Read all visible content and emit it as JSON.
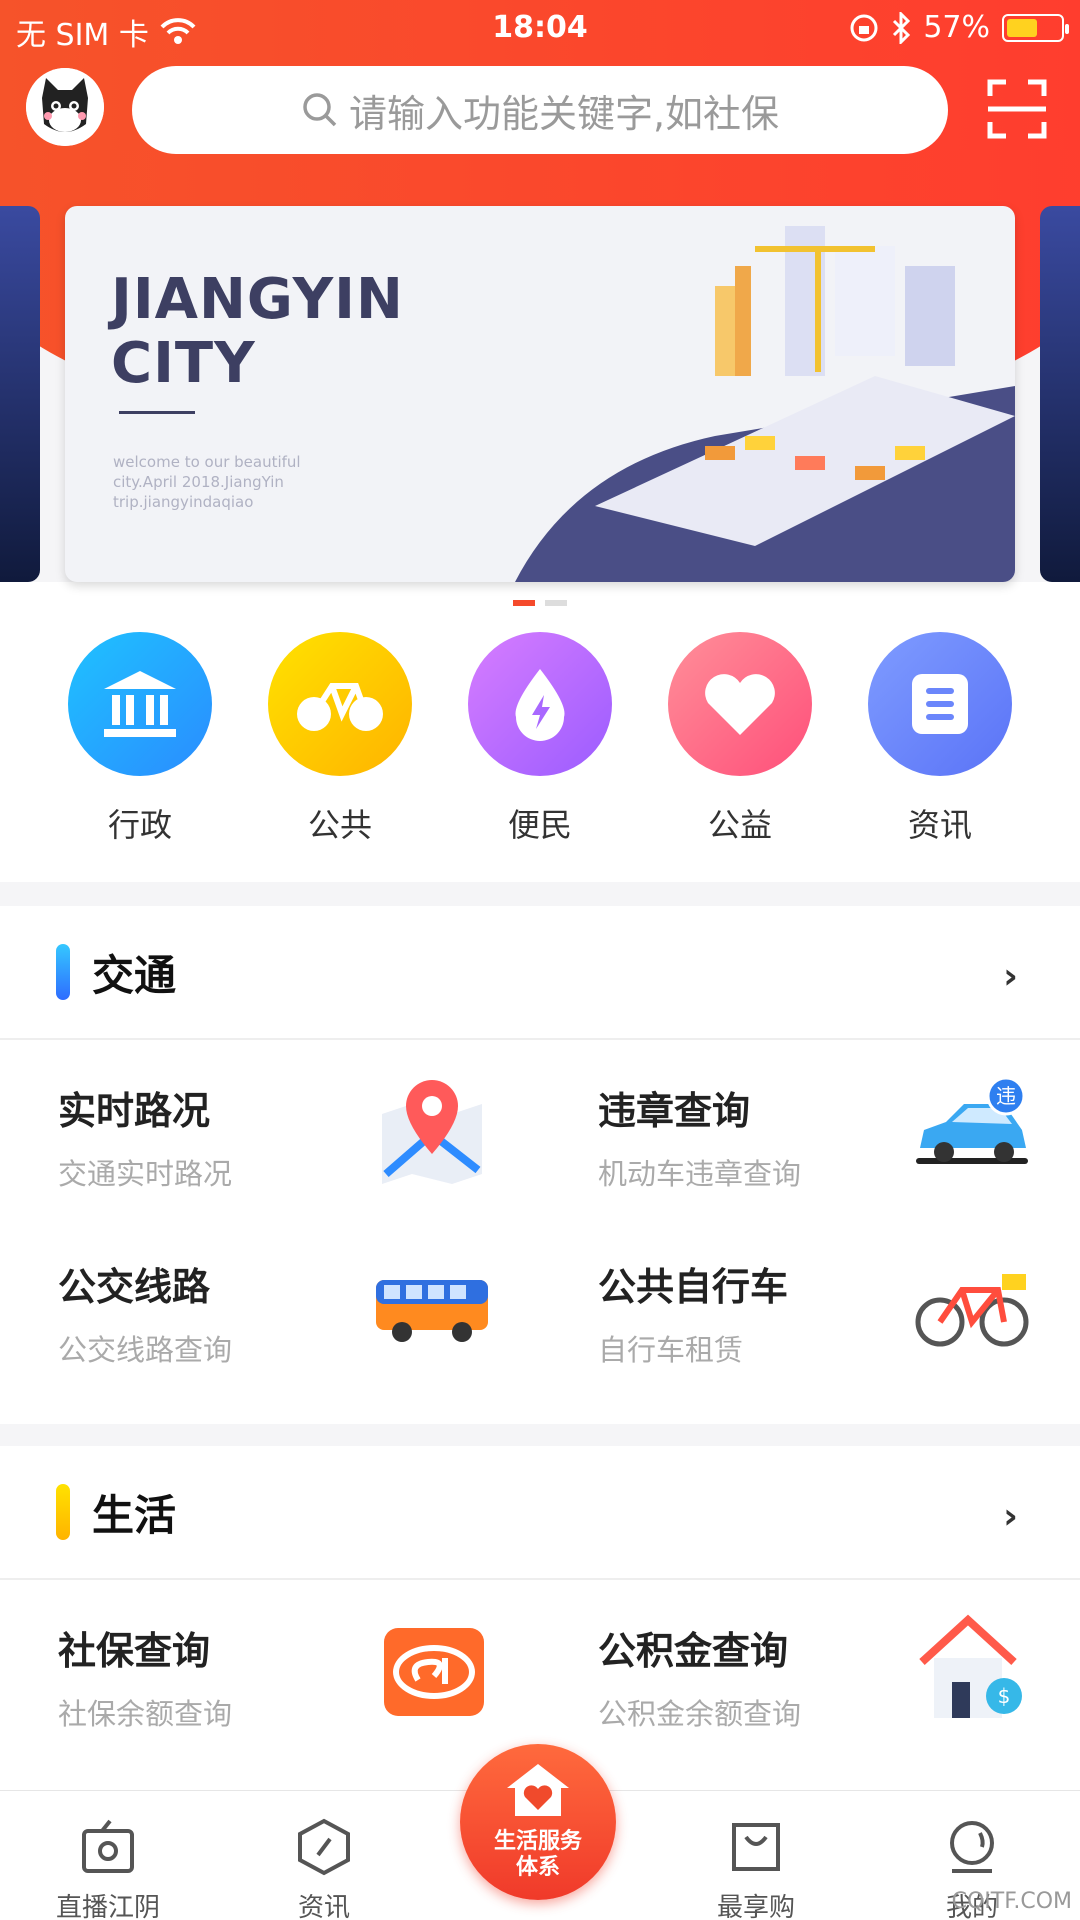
{
  "status": {
    "carrier": "无 SIM 卡",
    "time": "18:04",
    "battery": "57%",
    "battery_level": 0.57
  },
  "search": {
    "placeholder": "请输入功能关键字,如社保"
  },
  "banner": {
    "title": "JIANGYIN\nCITY",
    "subtitle": "welcome to our beautiful\ncity.April 2018.JiangYin\ntrip.jiangyindaqiao",
    "active_index": 0
  },
  "quick": [
    {
      "label": "行政",
      "icon": "government-building-icon",
      "color_from": "#1fc2ff",
      "color_to": "#2a8cff"
    },
    {
      "label": "公共",
      "icon": "bicycle-icon",
      "color_from": "#ffe200",
      "color_to": "#ffb300"
    },
    {
      "label": "便民",
      "icon": "water-drop-icon",
      "color_from": "#d77dff",
      "color_to": "#9b5cff"
    },
    {
      "label": "公益",
      "icon": "heart-icon",
      "color_from": "#ff8f99",
      "color_to": "#ff4f7a"
    },
    {
      "label": "资讯",
      "icon": "document-list-icon",
      "color_from": "#7f9cff",
      "color_to": "#5a73f7"
    }
  ],
  "traffic": {
    "title": "交通",
    "bar_color": "#2e8cff",
    "items": [
      {
        "title": "实时路况",
        "sub": "交通实时路况",
        "icon": "map-pin-icon"
      },
      {
        "title": "违章查询",
        "sub": "机动车违章查询",
        "icon": "car-icon",
        "badge": "违"
      },
      {
        "title": "公交线路",
        "sub": "公交线路查询",
        "icon": "bus-icon"
      },
      {
        "title": "公共自行车",
        "sub": "自行车租赁",
        "icon": "bicycle-icon"
      }
    ]
  },
  "life": {
    "title": "生活",
    "bar_color": "#ffc400",
    "items": [
      {
        "title": "社保查询",
        "sub": "社保余额查询",
        "icon": "social-security-logo-icon"
      },
      {
        "title": "公积金查询",
        "sub": "公积金余额查询",
        "icon": "house-fund-icon"
      }
    ]
  },
  "tabs": [
    {
      "label": "直播江阴",
      "icon": "live-tv-icon"
    },
    {
      "label": "资讯",
      "icon": "compass-icon"
    },
    {
      "label": "",
      "icon": ""
    },
    {
      "label": "最享购",
      "icon": "shopping-bag-icon"
    },
    {
      "label": "我的",
      "icon": "profile-icon"
    }
  ],
  "center_tab": {
    "line1": "生活服务",
    "line2": "体系"
  },
  "watermark": "CQITF.COM"
}
